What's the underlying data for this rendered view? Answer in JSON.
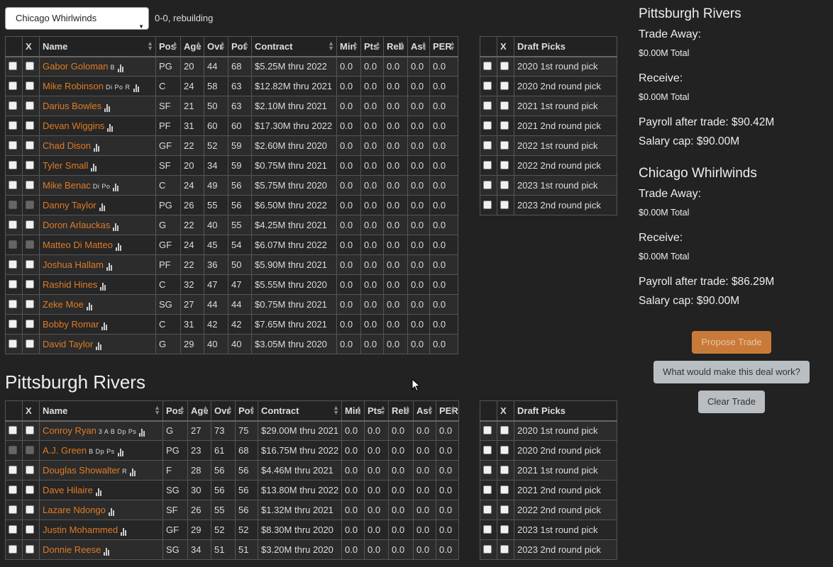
{
  "selector": {
    "value": "Chicago Whirlwinds",
    "record": "0-0, rebuilding"
  },
  "user_table": {
    "headers": [
      "X",
      "Name",
      "Pos",
      "Age",
      "Ovr",
      "Pot",
      "Contract",
      "Min",
      "Pts",
      "Reb",
      "Ast",
      "PER"
    ],
    "rows": [
      {
        "name": "Gabor Goloman",
        "skills": "B",
        "pos": "PG",
        "age": "20",
        "ovr": "44",
        "pot": "68",
        "contract": "$5.25M thru 2022",
        "disabled": false
      },
      {
        "name": "Mike Robinson",
        "skills": "Di Po R",
        "pos": "C",
        "age": "24",
        "ovr": "58",
        "pot": "63",
        "contract": "$12.82M thru 2021",
        "disabled": false
      },
      {
        "name": "Darius Bowles",
        "skills": "",
        "pos": "SF",
        "age": "21",
        "ovr": "50",
        "pot": "63",
        "contract": "$2.10M thru 2021",
        "disabled": false
      },
      {
        "name": "Devan Wiggins",
        "skills": "",
        "pos": "PF",
        "age": "31",
        "ovr": "60",
        "pot": "60",
        "contract": "$17.30M thru 2022",
        "disabled": false
      },
      {
        "name": "Chad Dison",
        "skills": "",
        "pos": "GF",
        "age": "22",
        "ovr": "52",
        "pot": "59",
        "contract": "$2.60M thru 2020",
        "disabled": false
      },
      {
        "name": "Tyler Small",
        "skills": "",
        "pos": "SF",
        "age": "20",
        "ovr": "34",
        "pot": "59",
        "contract": "$0.75M thru 2021",
        "disabled": false
      },
      {
        "name": "Mike Benac",
        "skills": "Di Po",
        "pos": "C",
        "age": "24",
        "ovr": "49",
        "pot": "56",
        "contract": "$5.75M thru 2020",
        "disabled": false
      },
      {
        "name": "Danny Taylor",
        "skills": "",
        "pos": "PG",
        "age": "26",
        "ovr": "55",
        "pot": "56",
        "contract": "$6.50M thru 2022",
        "disabled": true
      },
      {
        "name": "Doron Arlauckas",
        "skills": "",
        "pos": "G",
        "age": "22",
        "ovr": "40",
        "pot": "55",
        "contract": "$4.25M thru 2021",
        "disabled": false
      },
      {
        "name": "Matteo Di Matteo",
        "skills": "",
        "pos": "GF",
        "age": "24",
        "ovr": "45",
        "pot": "54",
        "contract": "$6.07M thru 2022",
        "disabled": true
      },
      {
        "name": "Joshua Hallam",
        "skills": "",
        "pos": "PF",
        "age": "22",
        "ovr": "36",
        "pot": "50",
        "contract": "$5.90M thru 2021",
        "disabled": false
      },
      {
        "name": "Rashid Hines",
        "skills": "",
        "pos": "C",
        "age": "32",
        "ovr": "47",
        "pot": "47",
        "contract": "$5.55M thru 2020",
        "disabled": false
      },
      {
        "name": "Zeke Moe",
        "skills": "",
        "pos": "SG",
        "age": "27",
        "ovr": "44",
        "pot": "44",
        "contract": "$0.75M thru 2021",
        "disabled": false
      },
      {
        "name": "Bobby Romar",
        "skills": "",
        "pos": "C",
        "age": "31",
        "ovr": "42",
        "pot": "42",
        "contract": "$7.65M thru 2021",
        "disabled": false
      },
      {
        "name": "David Taylor",
        "skills": "",
        "pos": "G",
        "age": "29",
        "ovr": "40",
        "pot": "40",
        "contract": "$3.05M thru 2020",
        "disabled": false
      }
    ],
    "stat_value": "0.0"
  },
  "user_picks": {
    "headers": [
      "X",
      "Draft Picks"
    ],
    "rows": [
      "2020 1st round pick",
      "2020 2nd round pick",
      "2021 1st round pick",
      "2021 2nd round pick",
      "2022 1st round pick",
      "2022 2nd round pick",
      "2023 1st round pick",
      "2023 2nd round pick"
    ]
  },
  "other_title": "Pittsburgh Rivers",
  "other_table": {
    "rows": [
      {
        "name": "Conroy Ryan",
        "skills": "3 A B Dp Ps",
        "pos": "G",
        "age": "27",
        "ovr": "73",
        "pot": "75",
        "contract": "$29.00M thru 2021",
        "disabled": false
      },
      {
        "name": "A.J. Green",
        "skills": "B Dp Ps",
        "pos": "PG",
        "age": "23",
        "ovr": "61",
        "pot": "68",
        "contract": "$16.75M thru 2022",
        "disabled": true
      },
      {
        "name": "Douglas Showalter",
        "skills": "R",
        "pos": "F",
        "age": "28",
        "ovr": "56",
        "pot": "56",
        "contract": "$4.46M thru 2021",
        "disabled": false
      },
      {
        "name": "Dave Hilaire",
        "skills": "",
        "pos": "SG",
        "age": "30",
        "ovr": "56",
        "pot": "56",
        "contract": "$13.80M thru 2022",
        "disabled": false
      },
      {
        "name": "Lazare Ndongo",
        "skills": "",
        "pos": "SF",
        "age": "26",
        "ovr": "55",
        "pot": "56",
        "contract": "$1.32M thru 2021",
        "disabled": false
      },
      {
        "name": "Justin Mohammed",
        "skills": "",
        "pos": "GF",
        "age": "29",
        "ovr": "52",
        "pot": "52",
        "contract": "$8.30M thru 2020",
        "disabled": false
      },
      {
        "name": "Donnie Reese",
        "skills": "",
        "pos": "SG",
        "age": "34",
        "ovr": "51",
        "pot": "51",
        "contract": "$3.20M thru 2020",
        "disabled": false
      }
    ]
  },
  "other_picks": {
    "rows": [
      "2020 1st round pick",
      "2020 2nd round pick",
      "2021 1st round pick",
      "2021 2nd round pick",
      "2022 2nd round pick",
      "2023 1st round pick",
      "2023 2nd round pick"
    ]
  },
  "summary": {
    "team1": {
      "name": "Pittsburgh Rivers",
      "trade_away": "Trade Away:",
      "away_total": "$0.00M Total",
      "receive": "Receive:",
      "receive_total": "$0.00M Total",
      "payroll": "Payroll after trade: $90.42M",
      "cap": "Salary cap: $90.00M"
    },
    "team2": {
      "name": "Chicago Whirlwinds",
      "trade_away": "Trade Away:",
      "away_total": "$0.00M Total",
      "receive": "Receive:",
      "receive_total": "$0.00M Total",
      "payroll": "Payroll after trade: $86.29M",
      "cap": "Salary cap: $90.00M"
    }
  },
  "buttons": {
    "propose": "Propose Trade",
    "what_would": "What would make this deal work?",
    "clear": "Clear Trade"
  },
  "colors": {
    "link": "#e07b24",
    "propose_bg": "#c97a39",
    "gray_btn": "#b9bec3",
    "background": "#222222"
  }
}
